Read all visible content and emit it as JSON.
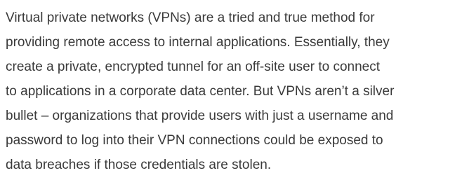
{
  "article": {
    "paragraph_lines": [
      "Virtual private networks (VPNs) are a tried and true method for",
      "providing remote access to internal applications. Essentially, they",
      "create a private, encrypted tunnel for an off-site user to connect",
      "to applications in a corporate data center. But VPNs aren’t a silver",
      "bullet – organizations that provide users with just a username and",
      "password to log into their VPN connections could be exposed to",
      "data breaches if those credentials are stolen."
    ]
  }
}
